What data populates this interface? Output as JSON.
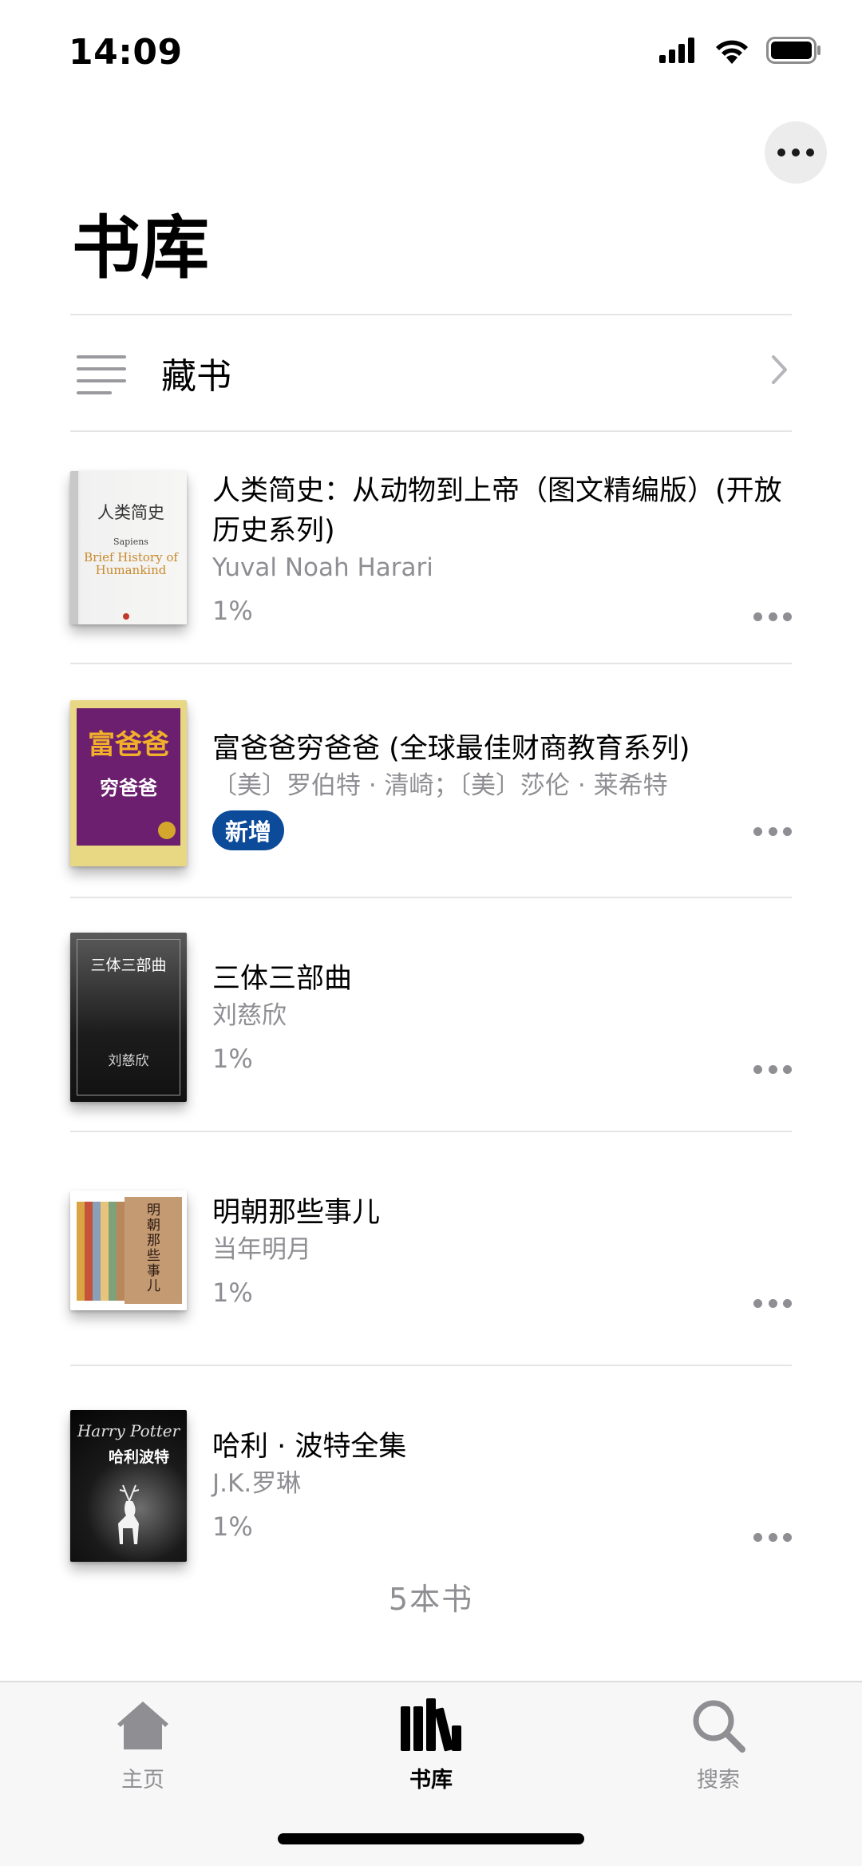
{
  "status_bar": {
    "time": "14:09",
    "icons": [
      "signal-icon",
      "wifi-icon",
      "battery-icon"
    ]
  },
  "header": {
    "title": "书库",
    "more_icon": "ellipsis-icon"
  },
  "collection": {
    "label": "藏书",
    "icon": "list-icon",
    "chevron": "chevron-right-icon"
  },
  "books": [
    {
      "title": "人类简史：从动物到上帝（图文精编版）(开放历史系列)",
      "author": "Yuval Noah Harari",
      "progress": "1%",
      "cover": {
        "main": "人类简史",
        "sub": "Sapiens",
        "en": "Brief History of Humankind"
      }
    },
    {
      "title": "富爸爸穷爸爸 (全球最佳财商教育系列)",
      "author": "〔美〕罗伯特 · 清崎；〔美〕莎伦 · 莱希特",
      "badge": "新增",
      "cover": {
        "main": "富爸爸",
        "sub": "穷爸爸"
      }
    },
    {
      "title": "三体三部曲",
      "author": "刘慈欣",
      "progress": "1%",
      "cover": {
        "main": "三体三部曲",
        "sub": "刘慈欣"
      }
    },
    {
      "title": "明朝那些事儿",
      "author": "当年明月",
      "progress": "1%",
      "cover": {
        "main": "明朝那些事儿"
      }
    },
    {
      "title": "哈利 · 波特全集",
      "author": "J.K.罗琳",
      "progress": "1%",
      "cover": {
        "main": "Harry Potter",
        "sub": "哈利波特"
      }
    }
  ],
  "footer": {
    "count": "5本书"
  },
  "tabs": [
    {
      "label": "主页",
      "icon": "home-icon",
      "active": false
    },
    {
      "label": "书库",
      "icon": "library-icon",
      "active": true
    },
    {
      "label": "搜索",
      "icon": "search-icon",
      "active": false
    }
  ],
  "colors": {
    "badge": "#0c4a9a",
    "secondary_text": "#8e8e93",
    "inactive_tab": "#8e8e93"
  }
}
